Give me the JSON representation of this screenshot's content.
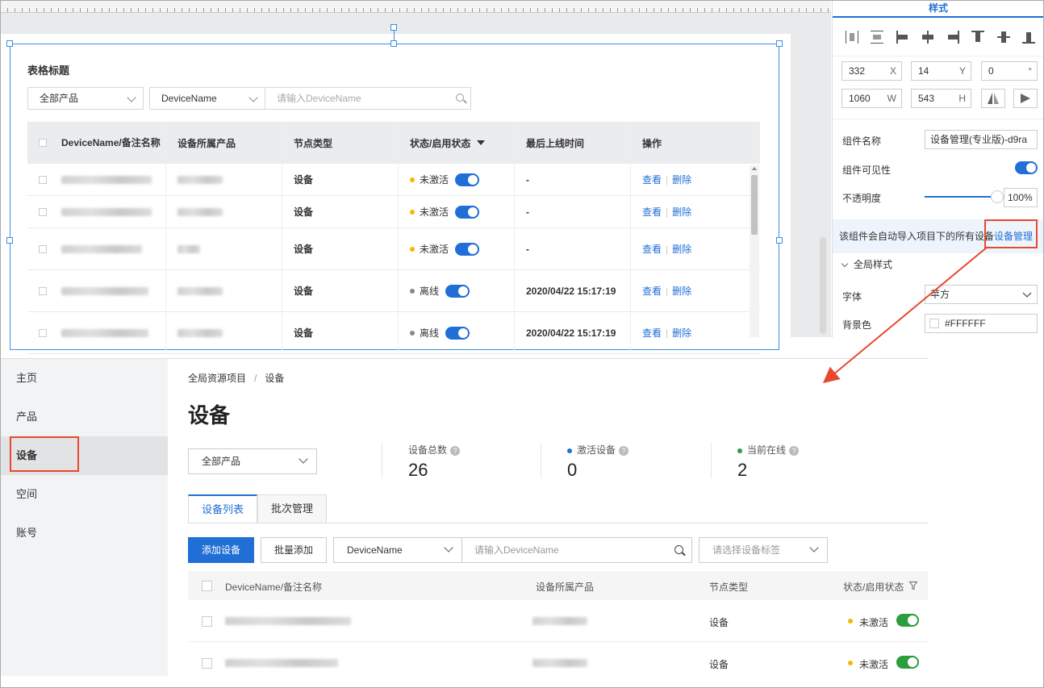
{
  "editor": {
    "widget_title": "表格标题",
    "product_select": "全部产品",
    "field_select": "DeviceName",
    "search_placeholder": "请输入DeviceName",
    "columns": [
      "DeviceName/备注名称",
      "设备所属产品",
      "节点类型",
      "状态/启用状态",
      "最后上线时间",
      "操作"
    ],
    "rows": [
      {
        "node": "设备",
        "status": "未激活",
        "status_color": "#f5b800",
        "last_online": "-",
        "view": "查看",
        "del": "删除"
      },
      {
        "node": "设备",
        "status": "未激活",
        "status_color": "#f5b800",
        "last_online": "-",
        "view": "查看",
        "del": "删除"
      },
      {
        "node": "设备",
        "status": "未激活",
        "status_color": "#f5b800",
        "last_online": "-",
        "view": "查看",
        "del": "删除"
      },
      {
        "node": "设备",
        "status": "离线",
        "status_color": "#888888",
        "last_online": "2020/04/22 15:17:19",
        "view": "查看",
        "del": "删除"
      },
      {
        "node": "设备",
        "status": "离线",
        "status_color": "#888888",
        "last_online": "2020/04/22 15:17:19",
        "view": "查看",
        "del": "删除"
      }
    ]
  },
  "props": {
    "tab": "样式",
    "x": "332",
    "x_unit": "X",
    "y": "14",
    "y_unit": "Y",
    "rot": "0",
    "rot_unit": "°",
    "w": "1060",
    "w_unit": "W",
    "h": "543",
    "h_unit": "H",
    "name_label": "组件名称",
    "name_value": "设备管理(专业版)-d9ra",
    "visible_label": "组件可见性",
    "opacity_label": "不透明度",
    "opacity_value": "100%",
    "note_text": "该组件会自动导入项目下的所有设备",
    "note_link": "设备管理",
    "global_style": "全局样式",
    "font_label": "字体",
    "font_value": "苹方",
    "bg_label": "背景色",
    "bg_value": "#FFFFFF"
  },
  "console": {
    "nav": [
      "主页",
      "产品",
      "设备",
      "空间",
      "账号"
    ],
    "breadcrumb_root": "全局资源项目",
    "breadcrumb_sep": "/",
    "breadcrumb_current": "设备",
    "title": "设备",
    "product_select": "全部产品",
    "stats": [
      {
        "label": "设备总数",
        "value": "26",
        "dot": ""
      },
      {
        "label": "激活设备",
        "value": "0",
        "dot": "#1f6fd6"
      },
      {
        "label": "当前在线",
        "value": "2",
        "dot": "#2b9e3e"
      }
    ],
    "tabs": [
      "设备列表",
      "批次管理"
    ],
    "add_btn": "添加设备",
    "batch_btn": "批量添加",
    "field_select": "DeviceName",
    "search_placeholder": "请输入DeviceName",
    "tag_placeholder": "请选择设备标签",
    "columns": [
      "DeviceName/备注名称",
      "设备所属产品",
      "节点类型",
      "状态/启用状态"
    ],
    "rows": [
      {
        "node": "设备",
        "status": "未激活"
      },
      {
        "node": "设备",
        "status": "未激活"
      }
    ]
  }
}
